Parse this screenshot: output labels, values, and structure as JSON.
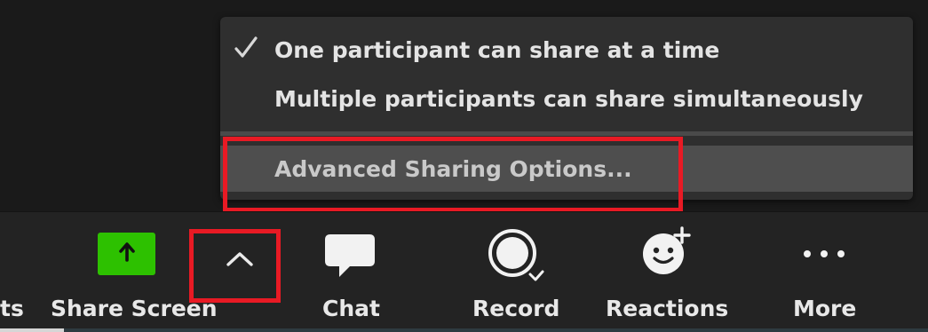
{
  "share_menu": {
    "items": [
      {
        "label": "One participant can share at a time",
        "checked": true
      },
      {
        "label": "Multiple participants can share simultaneously",
        "checked": false
      }
    ],
    "advanced_label": "Advanced Sharing Options..."
  },
  "toolbar": {
    "partial_label": "ts",
    "share_screen_label": "Share Screen",
    "chat_label": "Chat",
    "record_label": "Record",
    "reactions_label": "Reactions",
    "more_label": "More"
  },
  "colors": {
    "share_green": "#2dc100",
    "highlight_red": "#e81a24",
    "menu_bg": "#2f2f2f",
    "toolbar_bg": "#232323"
  },
  "icons": {
    "check": "check-icon",
    "share_arrow": "arrow-up-icon",
    "caret": "chevron-up-icon",
    "chat": "speech-bubble-icon",
    "record": "record-icon",
    "reactions": "smiley-plus-icon",
    "more": "ellipsis-icon"
  }
}
